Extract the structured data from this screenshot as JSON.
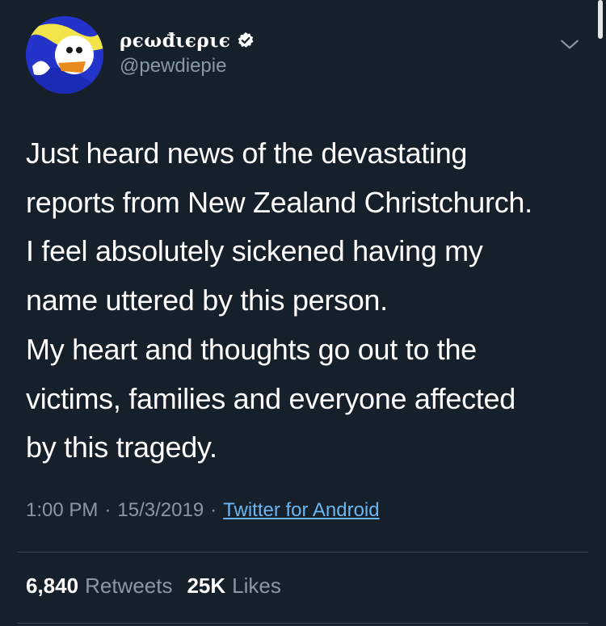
{
  "tweet": {
    "display_name": "ρєωđιєριє",
    "handle": "@pewdiepie",
    "text": "Just heard news of the devastating\nreports from New Zealand Christchurch.\nI feel absolutely sickened having my\nname uttered by this person.\nMy heart and thoughts go out to the\nvictims, families and everyone affected\nby this tragedy.",
    "time": "1:00 PM",
    "date": "15/3/2019",
    "source": "Twitter for Android",
    "retweets_count": "6,840",
    "retweets_label": "Retweets",
    "likes_count": "25K",
    "likes_label": "Likes"
  },
  "icons": {
    "verified": "verified-badge-icon",
    "menu": "chevron-down-icon"
  },
  "colors": {
    "background": "#15202b",
    "secondary_text": "#8899a6",
    "link": "#6bb5f0",
    "divider": "#38444d"
  }
}
